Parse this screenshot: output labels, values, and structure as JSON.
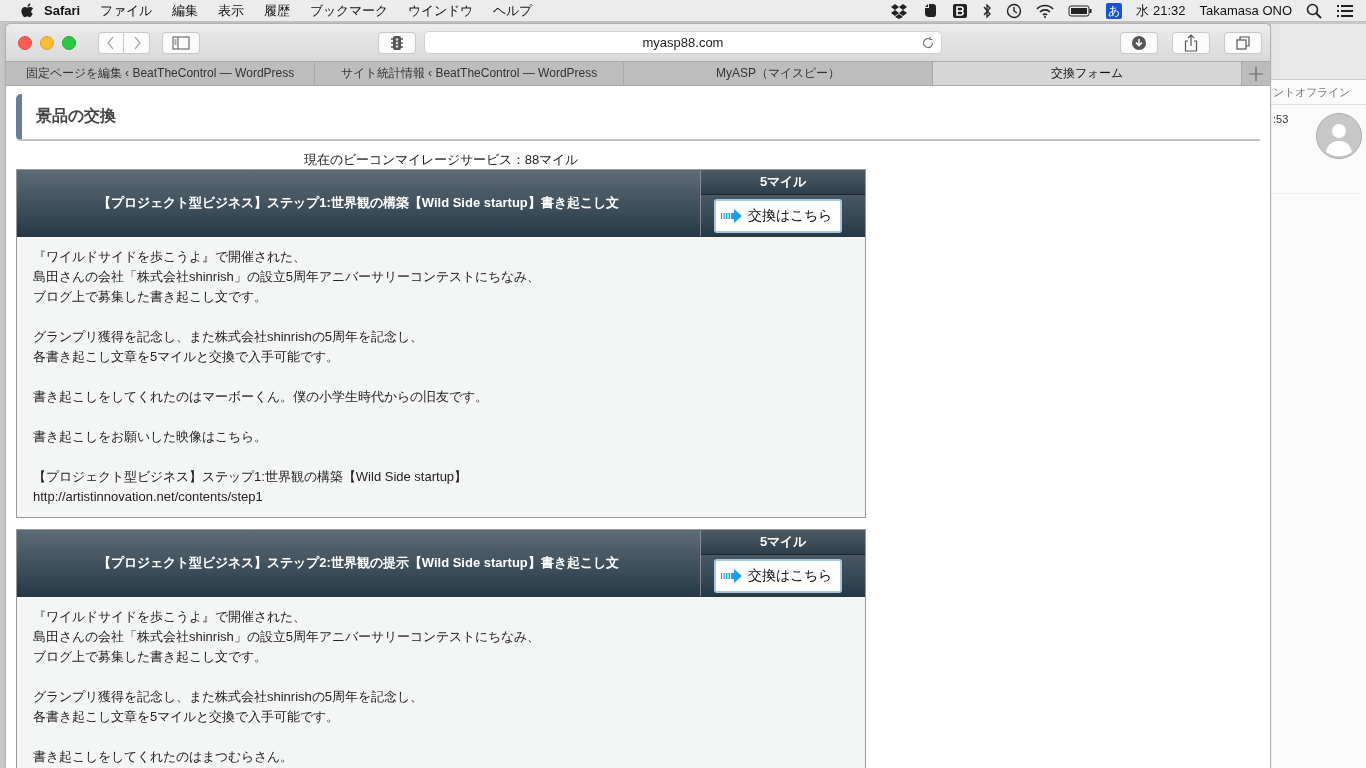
{
  "menubar": {
    "app": "Safari",
    "menus": [
      "ファイル",
      "編集",
      "表示",
      "履歴",
      "ブックマーク",
      "ウインドウ",
      "ヘルプ"
    ],
    "input_method": "あ",
    "clock": "水 21:32",
    "user": "Takamasa ONO"
  },
  "browser": {
    "url": "myasp88.com",
    "tabs": [
      {
        "label": "固定ページを編集 ‹ BeatTheControl — WordPress",
        "selected": false
      },
      {
        "label": "サイト統計情報 ‹ BeatTheControl — WordPress",
        "selected": false
      },
      {
        "label": "MyASP（マイスピー）",
        "selected": false
      },
      {
        "label": "交換フォーム",
        "selected": true
      }
    ],
    "page": {
      "heading": "景品の交換",
      "balance": "現在のビーコンマイレージサービス：88マイル",
      "items": [
        {
          "title": "【プロジェクト型ビジネス】ステップ1:世界観の構築【Wild Side startup】書き起こし文",
          "cost": "5マイル",
          "button": "交換はこちら",
          "paragraphs": [
            [
              "『ワイルドサイドを歩こうよ』で開催された、",
              "島田さんの会社「株式会社shinrish」の設立5周年アニバーサリーコンテストにちなみ、",
              "ブログ上で募集した書き起こし文です。"
            ],
            [
              "グランプリ獲得を記念し、また株式会社shinrishの5周年を記念し、",
              "各書き起こし文章を5マイルと交換で入手可能です。"
            ],
            [
              "書き起こしをしてくれたのはマーボーくん。僕の小学生時代からの旧友です。"
            ],
            [
              "書き起こしをお願いした映像はこちら。"
            ],
            [
              "【プロジェクト型ビジネス】ステップ1:世界観の構築【Wild Side startup】",
              "http://artistinnovation.net/contents/step1"
            ]
          ]
        },
        {
          "title": "【プロジェクト型ビジネス】ステップ2:世界観の提示【Wild Side startup】書き起こし文",
          "cost": "5マイル",
          "button": "交換はこちら",
          "paragraphs": [
            [
              "『ワイルドサイドを歩こうよ』で開催された、",
              "島田さんの会社「株式会社shinrish」の設立5周年アニバーサリーコンテストにちなみ、",
              "ブログ上で募集した書き起こし文です。"
            ],
            [
              "グランプリ獲得を記念し、また株式会社shinrishの5周年を記念し、",
              "各書き起こし文章を5マイルと交換で入手可能です。"
            ],
            [
              "書き起こしをしてくれたのはまつむらさん。"
            ]
          ]
        }
      ]
    }
  },
  "background_window": {
    "status": "ントオフライン",
    "time": ":53"
  }
}
